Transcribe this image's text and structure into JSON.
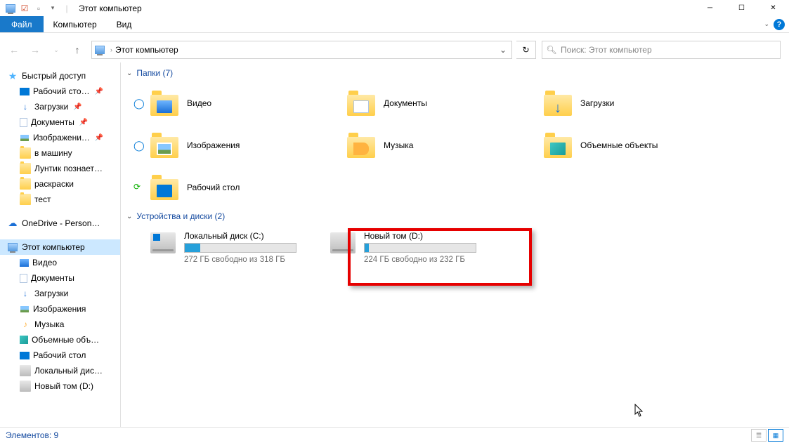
{
  "window": {
    "title": "Этот компьютер"
  },
  "ribbon": {
    "file": "Файл",
    "tabs": [
      "Компьютер",
      "Вид"
    ]
  },
  "address": {
    "text": "Этот компьютер"
  },
  "search": {
    "placeholder": "Поиск: Этот компьютер"
  },
  "sidebar": {
    "quick": "Быстрый доступ",
    "quickItems": [
      {
        "label": "Рабочий сто…",
        "pinned": true
      },
      {
        "label": "Загрузки",
        "pinned": true
      },
      {
        "label": "Документы",
        "pinned": true
      },
      {
        "label": "Изображени…",
        "pinned": true
      },
      {
        "label": "в машину",
        "pinned": false
      },
      {
        "label": "Лунтик познает…",
        "pinned": false
      },
      {
        "label": "раскраски",
        "pinned": false
      },
      {
        "label": "тест",
        "pinned": false
      }
    ],
    "onedrive": "OneDrive - Person…",
    "thispc": "Этот компьютер",
    "pcItems": [
      "Видео",
      "Документы",
      "Загрузки",
      "Изображения",
      "Музыка",
      "Объемные объ…",
      "Рабочий стол",
      "Локальный дис…",
      "Новый том (D:)"
    ]
  },
  "groups": {
    "folders": {
      "title": "Папки (7)"
    },
    "drives": {
      "title": "Устройства и диски (2)"
    }
  },
  "folders": [
    {
      "label": "Видео",
      "cloud": true
    },
    {
      "label": "Документы",
      "cloud": false
    },
    {
      "label": "Загрузки",
      "cloud": false
    },
    {
      "label": "Изображения",
      "cloud": true
    },
    {
      "label": "Музыка",
      "cloud": false
    },
    {
      "label": "Объемные объекты",
      "cloud": false
    },
    {
      "label": "Рабочий стол",
      "sync": true
    }
  ],
  "drives": [
    {
      "name": "Локальный диск (C:)",
      "free": "272 ГБ свободно из 318 ГБ",
      "fillPct": 14,
      "win": true
    },
    {
      "name": "Новый том (D:)",
      "free": "224 ГБ свободно из 232 ГБ",
      "fillPct": 4,
      "win": false
    }
  ],
  "status": {
    "items": "Элементов: 9"
  }
}
